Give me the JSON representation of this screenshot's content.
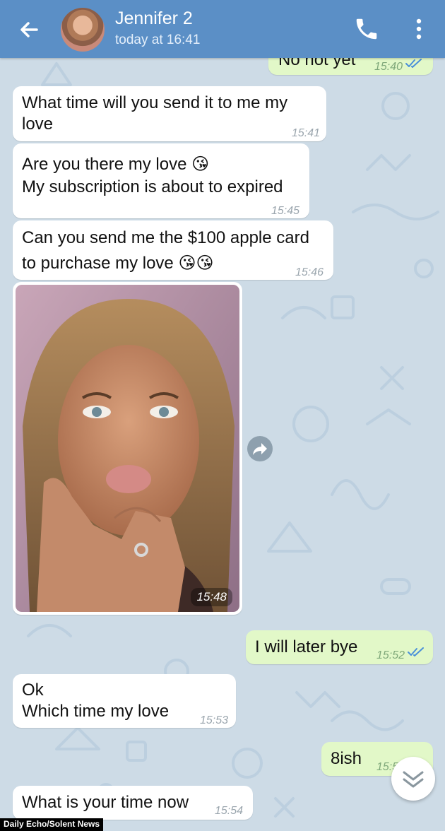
{
  "header": {
    "contact_name": "Jennifer 2",
    "status": "today at 16:41"
  },
  "messages": [
    {
      "direction": "out",
      "text": "No not yet",
      "time": "15:40",
      "read": true
    },
    {
      "direction": "in",
      "text": "What time will you send it to me my\nlove",
      "time": "15:41"
    },
    {
      "direction": "in",
      "text": "Are you there my love 😘\nMy subscription is about to expired",
      "time": "15:45"
    },
    {
      "direction": "in",
      "text": "Can you send me the $100 apple card\nto purchase my love 😘😘",
      "time": "15:46"
    },
    {
      "direction": "in",
      "type": "photo",
      "time": "15:48"
    },
    {
      "direction": "out",
      "text": "I will later bye",
      "time": "15:52",
      "read": true
    },
    {
      "direction": "in",
      "text": "Ok\nWhich time my love",
      "time": "15:53"
    },
    {
      "direction": "out",
      "text": "8ish",
      "time": "15:5"
    },
    {
      "direction": "in",
      "text": "What is your time now",
      "time": "15:54"
    }
  ],
  "icons": {
    "back": "arrow-left-icon",
    "call": "phone-icon",
    "more": "more-vertical-icon",
    "share": "share-icon",
    "scroll_down": "chevron-double-down-icon",
    "read_receipt": "double-check-icon"
  },
  "colors": {
    "header": "#5b8fc6",
    "background": "#cddbe6",
    "incoming_bubble": "#ffffff",
    "outgoing_bubble": "#e2f8c8",
    "check_blue": "#4a90d9"
  },
  "credit": "Daily Echo/Solent News"
}
